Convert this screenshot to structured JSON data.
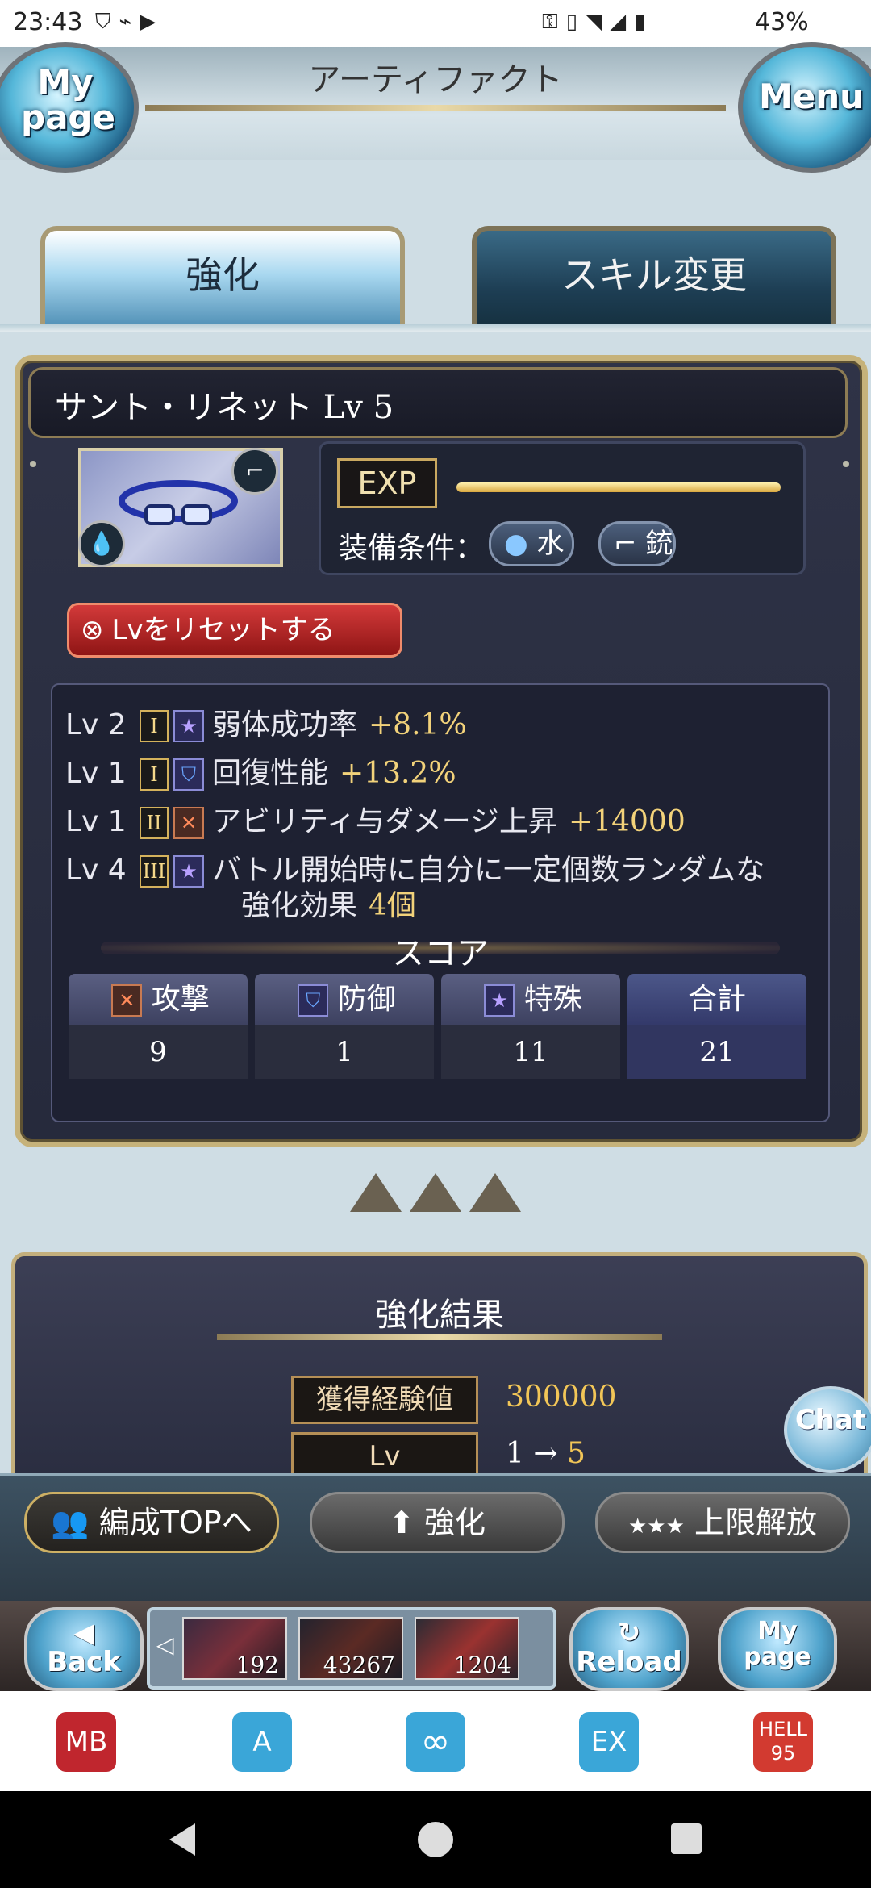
{
  "status_bar": {
    "time": "23:43",
    "left_icons": [
      "shield-icon",
      "app-icon",
      "youtube-icon"
    ],
    "right_icons": [
      "key-icon",
      "vibrate-icon",
      "wifi-icon",
      "signal-icon",
      "battery-icon"
    ],
    "battery": "43%"
  },
  "header": {
    "title": "アーティファクト",
    "mypage_label": "My page",
    "menu_label": "Menu"
  },
  "tabs": [
    {
      "label": "強化",
      "active": true
    },
    {
      "label": "スキル変更",
      "active": false
    }
  ],
  "artifact": {
    "name": "サント・リネット Lv 5",
    "exp_label": "EXP",
    "exp_fill": 1.0,
    "equip_condition_label": "装備条件：",
    "element": "水",
    "weapon": "銃",
    "reset_label": "Lvをリセットする"
  },
  "skills": [
    {
      "lv": "Lv 2",
      "tier": "I",
      "type": "special",
      "name": "弱体成功率",
      "value": "+8.1%"
    },
    {
      "lv": "Lv 1",
      "tier": "I",
      "type": "defense",
      "name": "回復性能",
      "value": "+13.2%"
    },
    {
      "lv": "Lv 1",
      "tier": "II",
      "type": "attack",
      "name": "アビリティ与ダメージ上昇",
      "value": "+14000"
    },
    {
      "lv": "Lv 4",
      "tier": "III",
      "type": "special",
      "name": "バトル開始時に自分に一定個数ランダムな",
      "name2": "強化効果",
      "value": "4個"
    }
  ],
  "score": {
    "title": "スコア",
    "columns": [
      {
        "label": "攻撃",
        "value": "9"
      },
      {
        "label": "防御",
        "value": "1"
      },
      {
        "label": "特殊",
        "value": "11"
      },
      {
        "label": "合計",
        "value": "21"
      }
    ]
  },
  "result": {
    "title": "強化結果",
    "exp_label": "獲得経験値",
    "exp_value": "300000",
    "lv_label": "Lv",
    "lv_from": "1",
    "lv_arrow": "→",
    "lv_to": "5",
    "chat_label": "Chat"
  },
  "actions": {
    "party_label": "編成TOPへ",
    "enhance_label": "強化",
    "uncap_label": "上限解放"
  },
  "nav": {
    "back_label": "Back",
    "reload_label": "Reload",
    "mypage_label": "My page",
    "items": [
      {
        "count": "192"
      },
      {
        "count": "43267"
      },
      {
        "count": "1204"
      }
    ]
  },
  "extensions": [
    {
      "label": "MB",
      "color": "#c0262e"
    },
    {
      "label": "A",
      "color": "#3aa6d8"
    },
    {
      "label": "∞",
      "color": "#3aa6d8"
    },
    {
      "label": "EX",
      "color": "#3aa6d8"
    },
    {
      "label": "HELL 95",
      "color": "#d23a30"
    }
  ]
}
